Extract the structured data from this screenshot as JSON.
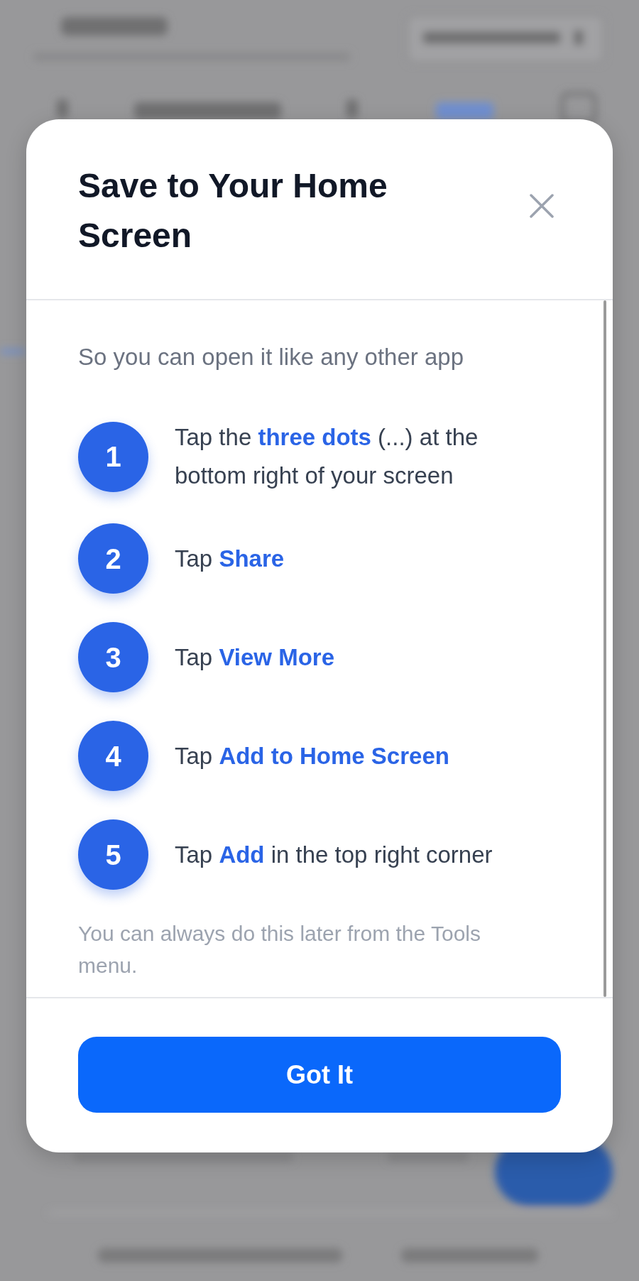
{
  "dialog": {
    "title": "Save to Your Home Screen",
    "subtitle": "So you can open it like any other app",
    "steps": [
      {
        "number": "1",
        "text": "Tap the **three dots** (...) at the bottom right of your screen"
      },
      {
        "number": "2",
        "text": "Tap **Share**"
      },
      {
        "number": "3",
        "text": "Tap **View More**"
      },
      {
        "number": "4",
        "text": "Tap **Add to Home Screen**"
      },
      {
        "number": "5",
        "text": "Tap **Add** in the top right corner"
      }
    ],
    "note": "You can always do this later from the Tools menu.",
    "button": "Got It"
  }
}
